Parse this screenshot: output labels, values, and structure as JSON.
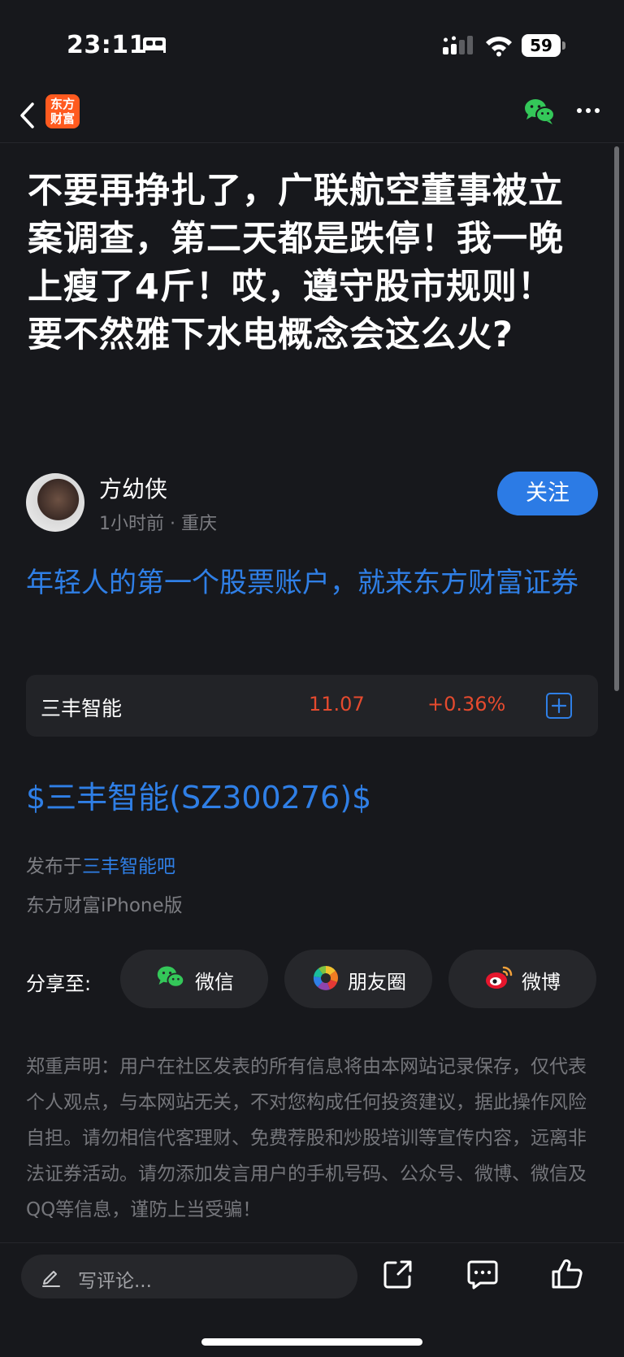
{
  "status_bar": {
    "time": "23:11",
    "battery": "59"
  },
  "nav": {
    "logo_line1": "东方",
    "logo_line2": "财富"
  },
  "article": {
    "title": "不要再挣扎了，广联航空董事被立案调查，第二天都是跌停！我一晚上瘦了4斤！哎，遵守股市规则！要不然雅下水电概念会这么火?",
    "author": "方幼侠",
    "meta": "1小时前 · 重庆",
    "follow_label": "关注",
    "promo": "年轻人的第一个股票账户，就来东方财富证券"
  },
  "stock_card": {
    "name": "三丰智能",
    "price": "11.07",
    "change": "+0.36%"
  },
  "stock_tag": "$三丰智能(SZ300276)$",
  "source": {
    "posted_prefix": "发布于",
    "forum": "三丰智能吧",
    "client": "东方财富iPhone版"
  },
  "share": {
    "label": "分享至:",
    "wechat": "微信",
    "moments": "朋友圈",
    "weibo": "微博"
  },
  "disclaimer": "郑重声明：用户在社区发表的所有信息将由本网站记录保存，仅代表个人观点，与本网站无关，不对您构成任何投资建议，据此操作风险自担。请勿相信代客理财、免费荐股和炒股培训等宣传内容，远离非法证券活动。请勿添加发言用户的手机号码、公众号、微博、微信及QQ等信息，谨防上当受骗！",
  "bottom_bar": {
    "comment_placeholder": "写评论..."
  },
  "colors": {
    "background": "#17181c",
    "accent_blue": "#2f7fe6",
    "follow_blue": "#2c7be5",
    "stock_red": "#e54a2e",
    "logo_orange": "#ff5a1f"
  }
}
